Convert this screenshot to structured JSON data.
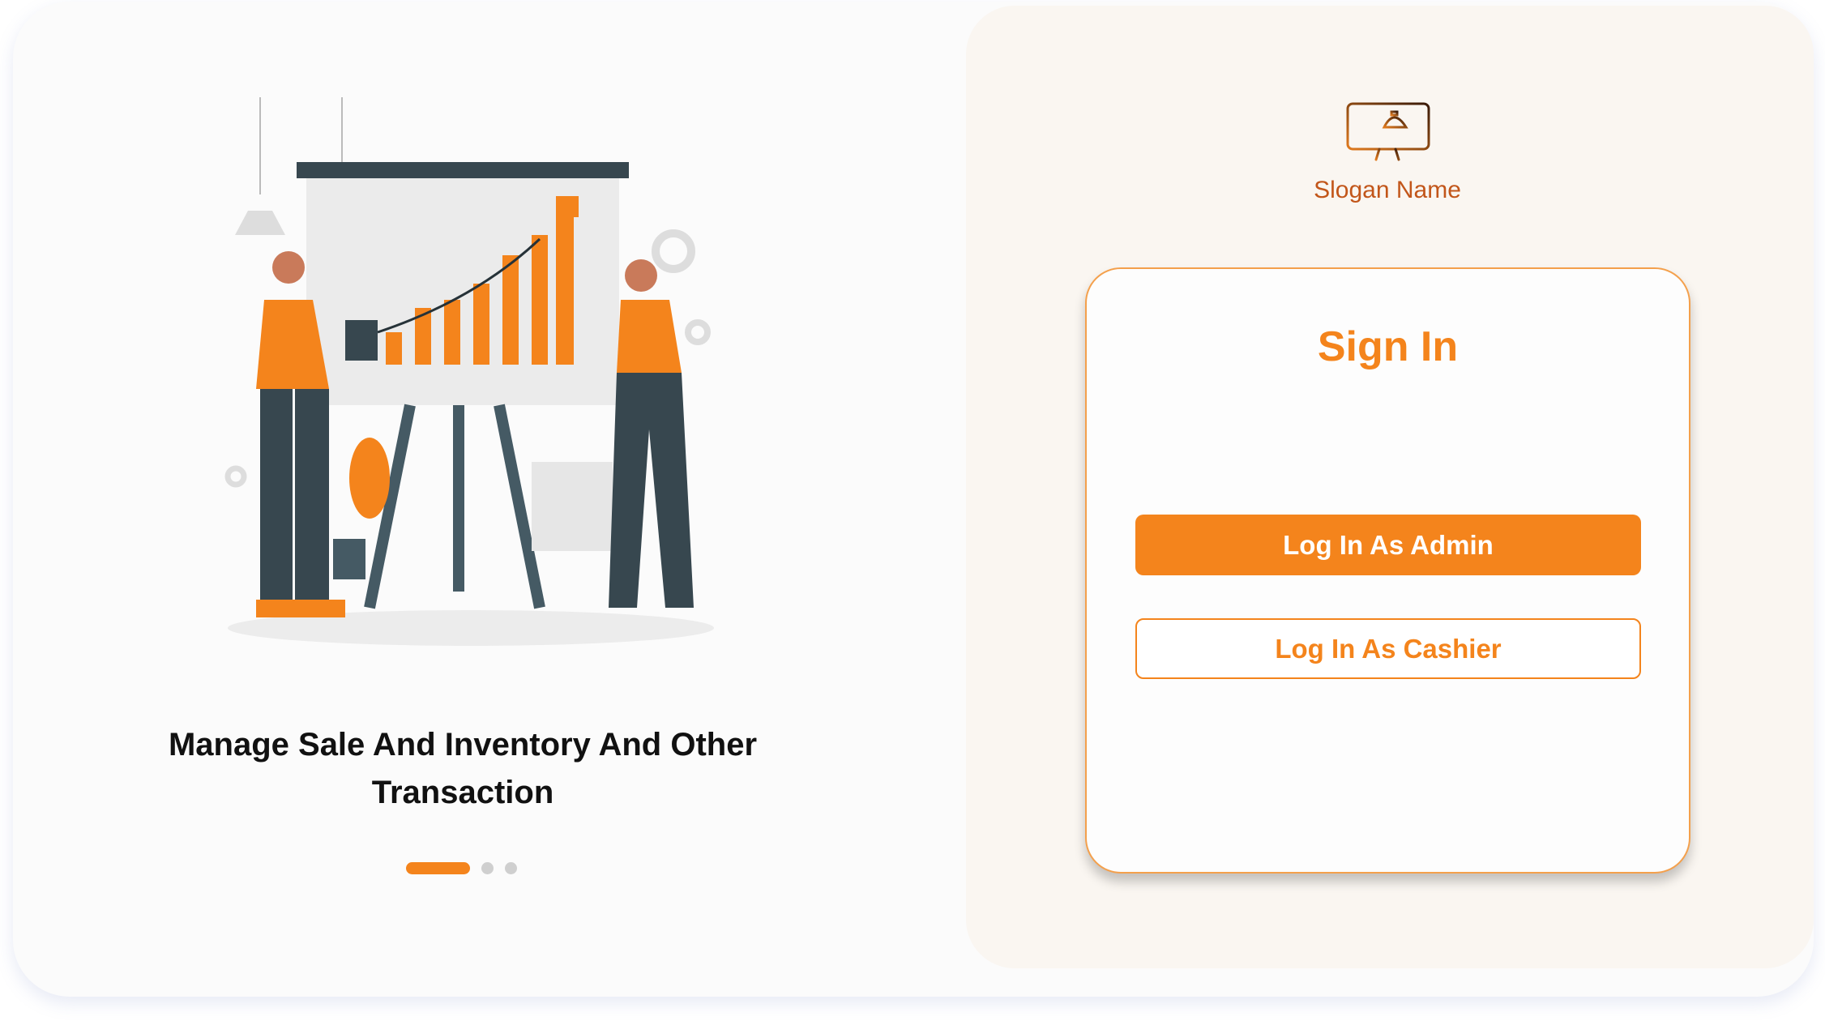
{
  "left_panel": {
    "caption": "Manage Sale And Inventory And Other Transaction",
    "carousel": {
      "total": 3,
      "active": 1
    }
  },
  "brand": {
    "logo_icon": "monitor-service-bell-icon",
    "slogan": "Slogan Name"
  },
  "signin": {
    "title": "Sign In",
    "admin_button": "Log In As Admin",
    "cashier_button": "Log In As Cashier"
  },
  "colors": {
    "accent": "#f4841c",
    "brand_text": "#c2561a",
    "panel_bg": "#faf6f1"
  }
}
